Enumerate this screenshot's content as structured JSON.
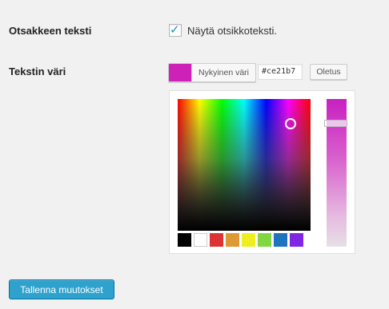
{
  "settings": {
    "header_text_label": "Otsakkeen teksti",
    "show_header_text_label": "Näytä otsikkoteksti.",
    "show_header_text_checked": true,
    "text_color_label": "Tekstin väri"
  },
  "color_picker": {
    "current_color_label": "Nykyinen väri",
    "current_color": "#ce21b7",
    "hex_value": "#ce21b7",
    "default_label": "Oletus",
    "palette": [
      "#000000",
      "#ffffff",
      "#dd3333",
      "#dd9933",
      "#eeee22",
      "#81d742",
      "#1e73be",
      "#8224e3"
    ]
  },
  "footer": {
    "save_label": "Tallenna muutokset"
  }
}
